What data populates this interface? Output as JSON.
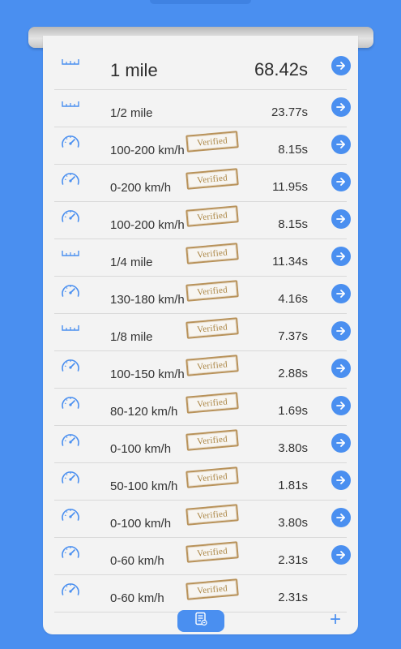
{
  "colors": {
    "background": "#4a8ff0",
    "accent": "#4a8ff0",
    "stamp": "#b8925a"
  },
  "rows": [
    {
      "icon": "ruler-icon",
      "label": "1 mile",
      "value": "68.42s",
      "verified": false,
      "has_action": true
    },
    {
      "icon": "ruler-icon",
      "label": "1/2 mile",
      "value": "23.77s",
      "verified": false,
      "has_action": true
    },
    {
      "icon": "speedometer-icon",
      "label": "100-200 km/h",
      "value": "8.15s",
      "verified": true,
      "has_action": true
    },
    {
      "icon": "speedometer-icon",
      "label": "0-200 km/h",
      "value": "11.95s",
      "verified": true,
      "has_action": true
    },
    {
      "icon": "speedometer-icon",
      "label": "100-200 km/h",
      "value": "8.15s",
      "verified": true,
      "has_action": true
    },
    {
      "icon": "ruler-icon",
      "label": "1/4 mile",
      "value": "11.34s",
      "verified": true,
      "has_action": true
    },
    {
      "icon": "speedometer-icon",
      "label": "130-180 km/h",
      "value": "4.16s",
      "verified": true,
      "has_action": true
    },
    {
      "icon": "ruler-icon",
      "label": "1/8 mile",
      "value": "7.37s",
      "verified": true,
      "has_action": true
    },
    {
      "icon": "speedometer-icon",
      "label": "100-150 km/h",
      "value": "2.88s",
      "verified": true,
      "has_action": true
    },
    {
      "icon": "speedometer-icon",
      "label": "80-120 km/h",
      "value": "1.69s",
      "verified": true,
      "has_action": true
    },
    {
      "icon": "speedometer-icon",
      "label": "0-100 km/h",
      "value": "3.80s",
      "verified": true,
      "has_action": true
    },
    {
      "icon": "speedometer-icon",
      "label": "50-100 km/h",
      "value": "1.81s",
      "verified": true,
      "has_action": true
    },
    {
      "icon": "speedometer-icon",
      "label": "0-100 km/h",
      "value": "3.80s",
      "verified": true,
      "has_action": true
    },
    {
      "icon": "speedometer-icon",
      "label": "0-60 km/h",
      "value": "2.31s",
      "verified": true,
      "has_action": true
    },
    {
      "icon": "speedometer-icon",
      "label": "0-60 km/h",
      "value": "2.31s",
      "verified": true,
      "has_action": false
    }
  ],
  "stamp_text": "Verified",
  "toolbar": {
    "report_icon": "report-icon",
    "add_label": "+"
  }
}
